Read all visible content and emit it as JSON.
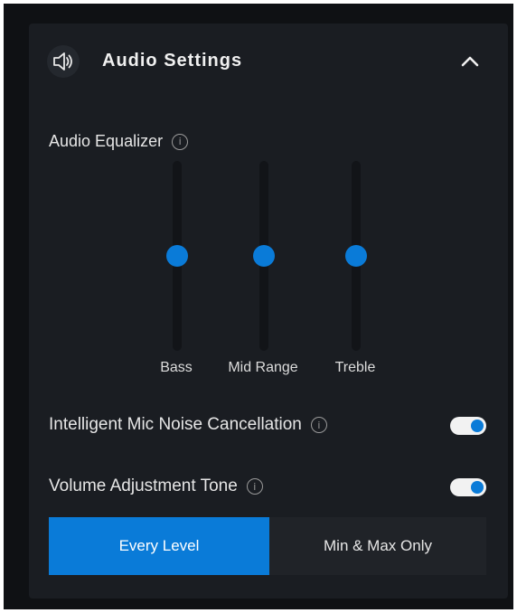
{
  "header": {
    "title": "Audio Settings",
    "icon": "speaker-icon",
    "collapse_icon": "chevron-up-icon"
  },
  "equalizer": {
    "label": "Audio Equalizer",
    "info_glyph": "i",
    "sliders": [
      {
        "label": "Bass",
        "level": 0.5
      },
      {
        "label": "Mid Range",
        "level": 0.5
      },
      {
        "label": "Treble",
        "level": 0.5
      }
    ]
  },
  "mic_noise": {
    "label": "Intelligent Mic Noise Cancellation",
    "info_glyph": "i",
    "enabled": true
  },
  "volume_tone": {
    "label": "Volume Adjustment Tone",
    "info_glyph": "i",
    "enabled": true,
    "options": [
      "Every Level",
      "Min & Max Only"
    ],
    "selected": "Every Level"
  },
  "colors": {
    "accent": "#0a7bd8",
    "panel": "#1a1d22",
    "background": "#0f1114"
  }
}
